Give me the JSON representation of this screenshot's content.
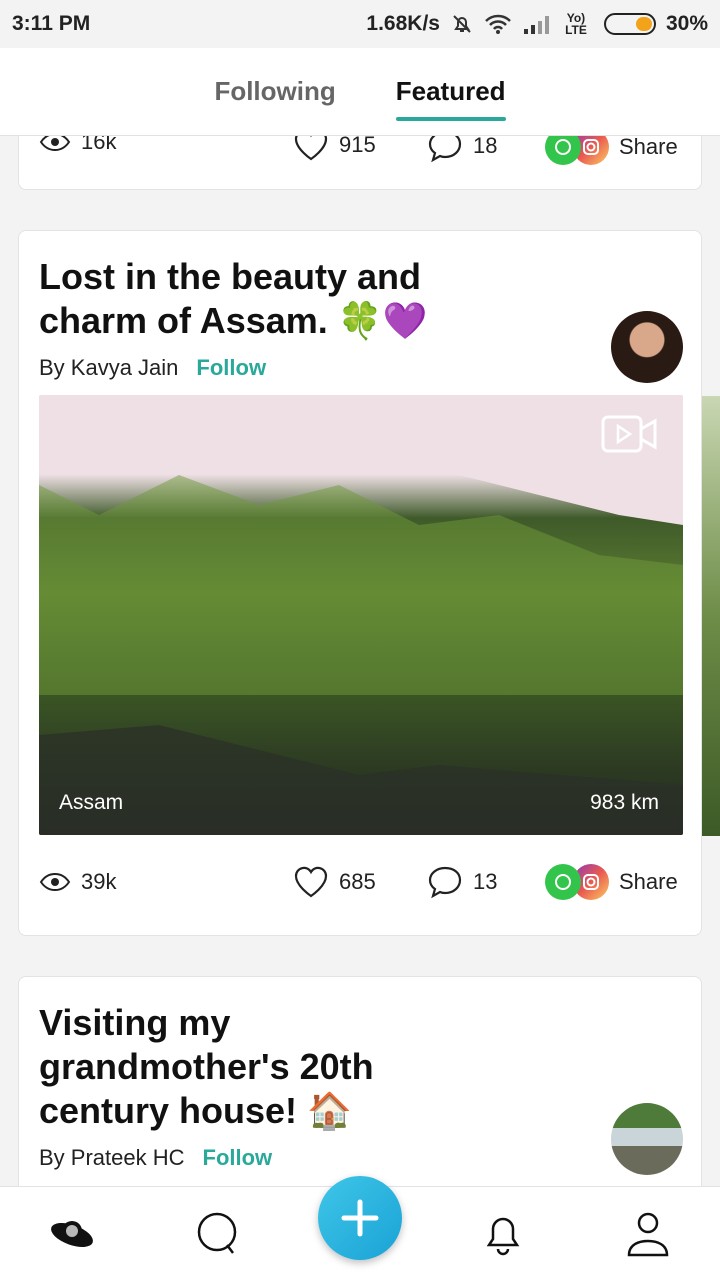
{
  "status_bar": {
    "time": "3:11 PM",
    "network_speed": "1.68K/s",
    "volte": "Yo) LTE",
    "battery": "30%"
  },
  "tabs": [
    {
      "label": "Following",
      "active": false
    },
    {
      "label": "Featured",
      "active": true
    }
  ],
  "prev_card": {
    "views": "16k",
    "likes": "915",
    "comments": "18",
    "share_label": "Share"
  },
  "cards": [
    {
      "title_line1": "Lost in the beauty and",
      "title_line2": "charm of Assam. 🍀💜",
      "author": "By Kavya Jain",
      "follow_label": "Follow",
      "location": "Assam",
      "distance": "983 km",
      "views": "39k",
      "likes": "685",
      "comments": "13",
      "share_label": "Share"
    },
    {
      "title_line1": "Visiting my",
      "title_line2": "grandmother's 20th",
      "title_line3": "century house! 🏠",
      "author": "By Prateek HC",
      "follow_label": "Follow"
    }
  ],
  "bottom_nav": [
    "home-icon",
    "search-icon",
    "add-icon",
    "notifications-icon",
    "profile-icon"
  ],
  "colors": {
    "accent": "#2aa99b",
    "fab": "#1aa2d6"
  }
}
